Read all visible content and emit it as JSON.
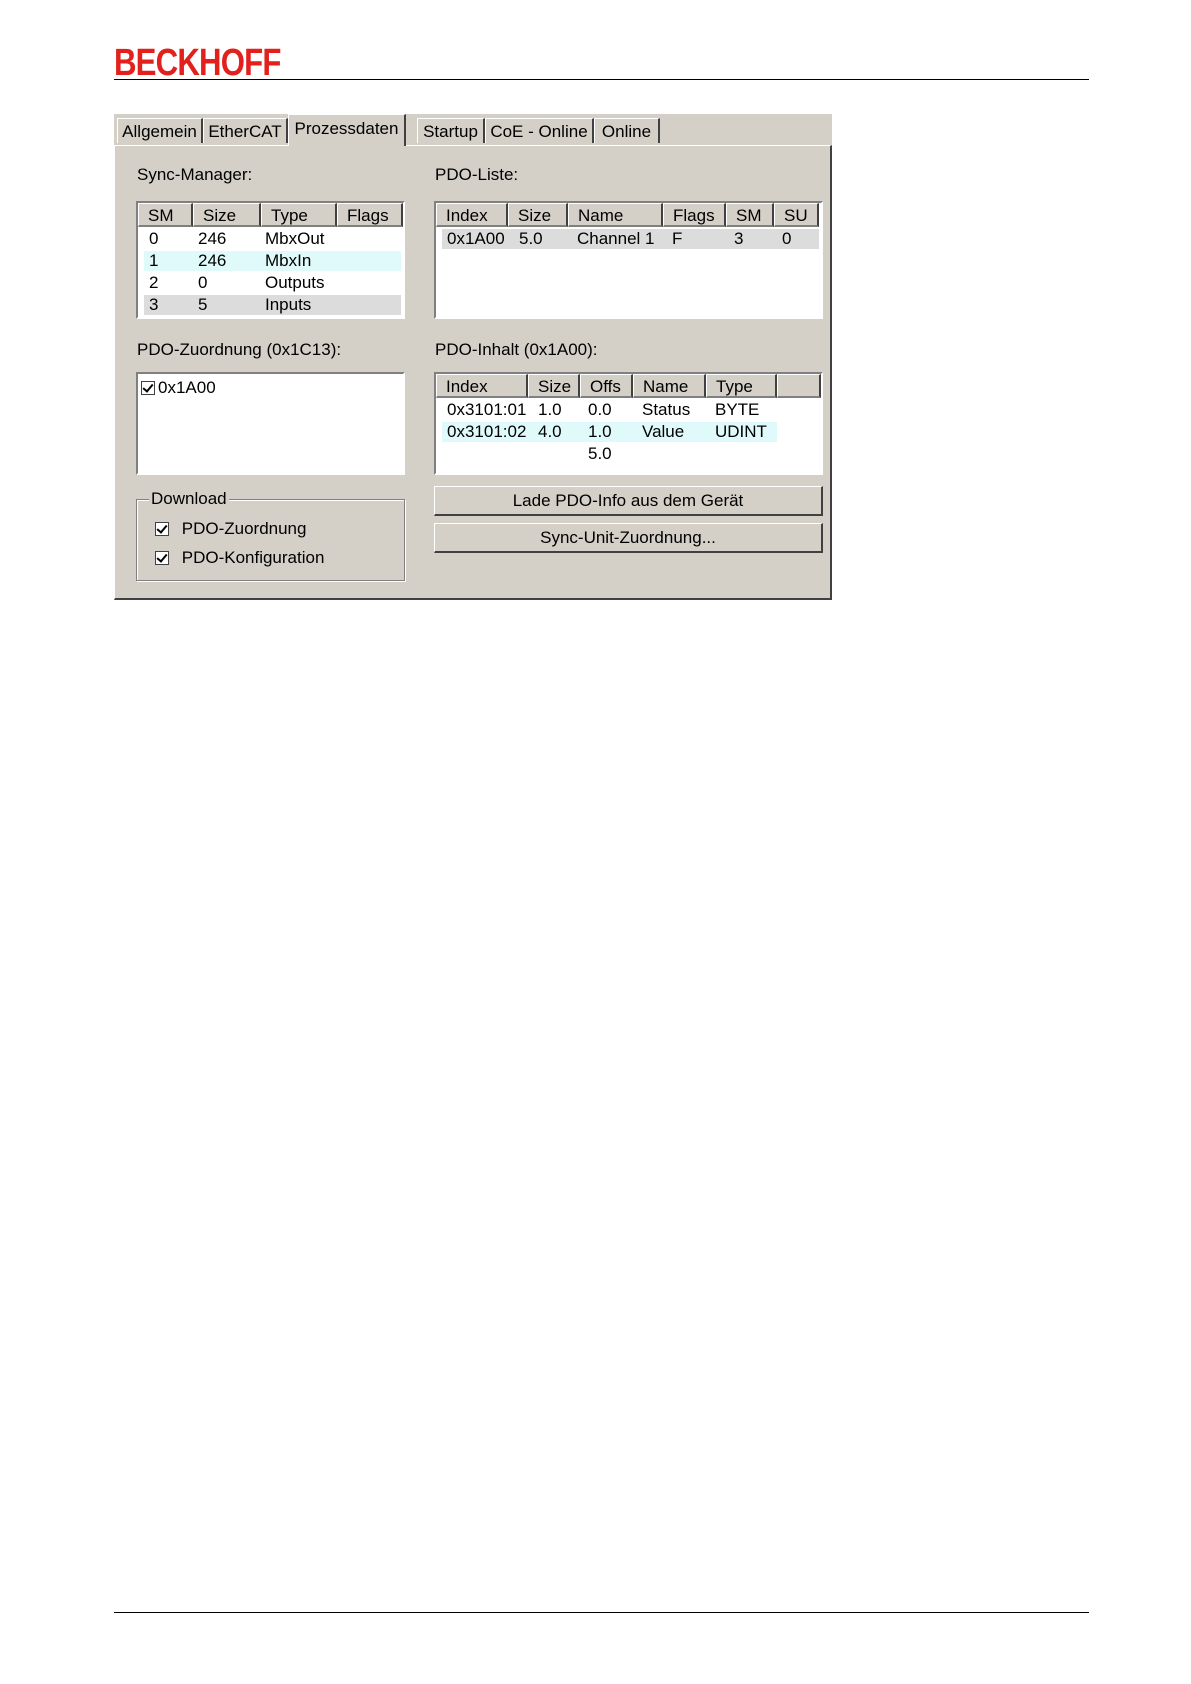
{
  "brand": {
    "logo_text": "BECKHOFF",
    "color": "#e2211c"
  },
  "tabs": [
    "Allgemein",
    "EtherCAT",
    "Prozessdaten",
    "Startup",
    "CoE - Online",
    "Online"
  ],
  "sync_manager": {
    "label": "Sync-Manager:",
    "columns": [
      "SM",
      "Size",
      "Type",
      "Flags"
    ],
    "rows": [
      [
        "0",
        "246",
        "MbxOut",
        ""
      ],
      [
        "1",
        "246",
        "MbxIn",
        ""
      ],
      [
        "2",
        "0",
        "Outputs",
        ""
      ],
      [
        "3",
        "5",
        "Inputs",
        ""
      ]
    ]
  },
  "pdo_list": {
    "label": "PDO-Liste:",
    "columns": [
      "Index",
      "Size",
      "Name",
      "Flags",
      "SM",
      "SU"
    ],
    "rows": [
      [
        "0x1A00",
        "5.0",
        "Channel 1",
        "F",
        "3",
        "0"
      ]
    ]
  },
  "pdo_assignment": {
    "label": "PDO-Zuordnung (0x1C13):",
    "items": [
      {
        "label": "0x1A00",
        "checked": true
      }
    ]
  },
  "pdo_content": {
    "label": "PDO-Inhalt (0x1A00):",
    "columns": [
      "Index",
      "Size",
      "Offs",
      "Name",
      "Type",
      ""
    ],
    "rows": [
      [
        "0x3101:01",
        "1.0",
        "0.0",
        "Status",
        "BYTE"
      ],
      [
        "0x3101:02",
        "4.0",
        "1.0",
        "Value",
        "UDINT"
      ],
      [
        "",
        "",
        "5.0",
        "",
        ""
      ]
    ]
  },
  "download": {
    "title": "Download",
    "assignment_label": "PDO-Zuordnung",
    "assignment_checked": true,
    "config_label": "PDO-Konfiguration",
    "config_checked": true
  },
  "buttons": {
    "load_pdo": "Lade PDO-Info aus dem Gerät",
    "sync_unit": "Sync-Unit-Zuordnung..."
  }
}
